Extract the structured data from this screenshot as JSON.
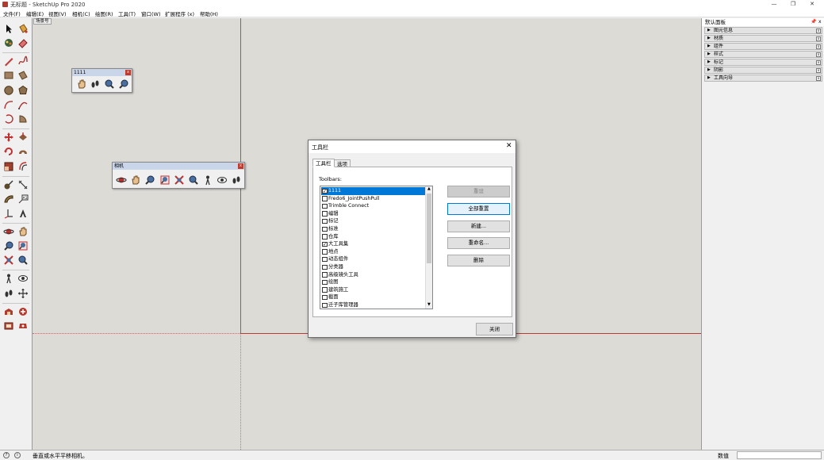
{
  "window": {
    "title": "无标题 - SketchUp Pro 2020",
    "min_glyph": "—",
    "max_glyph": "❐",
    "close_glyph": "✕"
  },
  "menu": [
    "文件(F)",
    "编辑(E)",
    "视图(V)",
    "相机(C)",
    "绘图(R)",
    "工具(T)",
    "窗口(W)",
    "扩展程序 (x)",
    "帮助(H)"
  ],
  "viewport": {
    "scene_tab": "场景号"
  },
  "floating_toolbars": {
    "custom": {
      "title": "1111",
      "close": "x"
    },
    "camera": {
      "title": "相机",
      "close": "x"
    }
  },
  "right_panel": {
    "title": "默认面板",
    "pin": "📌",
    "close": "x",
    "trays": [
      "图元信息",
      "材质",
      "组件",
      "样式",
      "标记",
      "阴影",
      "工具向导"
    ],
    "tray_arrow": "▶",
    "tray_close": "x"
  },
  "dialog": {
    "title": "工具栏",
    "close": "✕",
    "tabs": {
      "toolbars": "工具栏",
      "options": "选项"
    },
    "list_label": "Toolbars:",
    "items": [
      {
        "label": "1111",
        "checked": true,
        "selected": true
      },
      {
        "label": "Fredo6_JointPushPull",
        "checked": false
      },
      {
        "label": "Trimble Connect",
        "checked": false
      },
      {
        "label": "编辑",
        "checked": false
      },
      {
        "label": "标记",
        "checked": false
      },
      {
        "label": "标准",
        "checked": false
      },
      {
        "label": "仓库",
        "checked": false
      },
      {
        "label": "大工具集",
        "checked": true
      },
      {
        "label": "地点",
        "checked": false
      },
      {
        "label": "动态组件",
        "checked": false
      },
      {
        "label": "分类器",
        "checked": false
      },
      {
        "label": "高级镜头工具",
        "checked": false
      },
      {
        "label": "绘图",
        "checked": false
      },
      {
        "label": "建筑施工",
        "checked": false
      },
      {
        "label": "截面",
        "checked": false
      },
      {
        "label": "迁子库管理器",
        "checked": false
      }
    ],
    "check_glyph": "✓",
    "buttons": {
      "reset": "重设",
      "reset_all": "全部重置",
      "new": "新建...",
      "rename": "重命名...",
      "delete": "删除",
      "close": "关闭"
    }
  },
  "statusbar": {
    "info_glyph": "?",
    "user_glyph": "i",
    "message": "垂直或水平平移相机。",
    "measurements_label": "数值",
    "measurements_value": ""
  },
  "colors": {
    "axis_green": "#3f8f3f",
    "axis_red": "#b73a3a",
    "viewport_bg": "#dcdbd6",
    "selection": "#0078d7"
  }
}
